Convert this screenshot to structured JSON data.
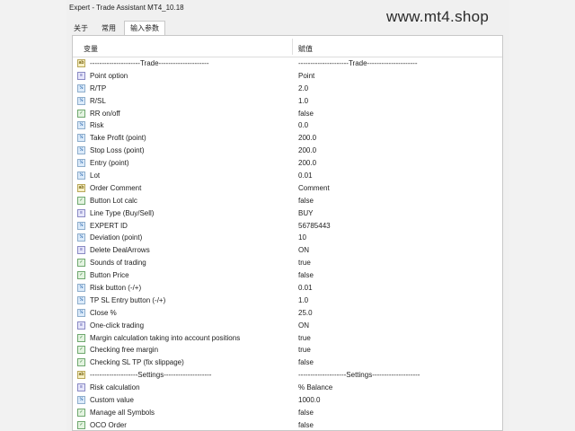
{
  "window": {
    "title": "Expert - Trade Assistant MT4_10.18",
    "watermark": "www.mt4.shop"
  },
  "tabs": [
    {
      "label": "关于",
      "active": false
    },
    {
      "label": "常用",
      "active": false
    },
    {
      "label": "输入参数",
      "active": true
    }
  ],
  "table": {
    "columns": {
      "variable": "变量",
      "value": "赋值"
    },
    "rows": [
      {
        "name": "---------------------Trade---------------------",
        "value": "---------------------Trade---------------------",
        "type": "text",
        "icon": "text-icon"
      },
      {
        "name": "Point option",
        "value": "Point",
        "type": "enum",
        "icon": "enum-icon"
      },
      {
        "name": "R/TP",
        "value": "2.0",
        "type": "number",
        "icon": "number-icon"
      },
      {
        "name": "R/SL",
        "value": "1.0",
        "type": "number",
        "icon": "number-icon"
      },
      {
        "name": "RR on/off",
        "value": "false",
        "type": "bool",
        "icon": "bool-icon"
      },
      {
        "name": "Risk",
        "value": "0.0",
        "type": "number",
        "icon": "number-icon"
      },
      {
        "name": "Take Profit (point)",
        "value": "200.0",
        "type": "number",
        "icon": "number-icon"
      },
      {
        "name": "Stop Loss (point)",
        "value": "200.0",
        "type": "number",
        "icon": "number-icon"
      },
      {
        "name": "Entry (point)",
        "value": "200.0",
        "type": "number",
        "icon": "number-icon"
      },
      {
        "name": "Lot",
        "value": "0.01",
        "type": "number",
        "icon": "number-icon"
      },
      {
        "name": "Order Comment",
        "value": "Comment",
        "type": "text",
        "icon": "text-icon"
      },
      {
        "name": "Button Lot calc",
        "value": "false",
        "type": "bool",
        "icon": "bool-icon"
      },
      {
        "name": "Line Type (Buy/Sell)",
        "value": "BUY",
        "type": "enum",
        "icon": "enum-icon"
      },
      {
        "name": "EXPERT ID",
        "value": "56785443",
        "type": "number",
        "icon": "number-icon"
      },
      {
        "name": "Deviation (point)",
        "value": "10",
        "type": "number",
        "icon": "number-icon"
      },
      {
        "name": "Delete DealArrows",
        "value": "ON",
        "type": "enum",
        "icon": "enum-icon"
      },
      {
        "name": "Sounds of trading",
        "value": "true",
        "type": "bool",
        "icon": "bool-icon"
      },
      {
        "name": "Button Price",
        "value": "false",
        "type": "bool",
        "icon": "bool-icon"
      },
      {
        "name": "Risk button (-/+)",
        "value": "0.01",
        "type": "number",
        "icon": "number-icon"
      },
      {
        "name": "TP SL Entry button (-/+)",
        "value": "1.0",
        "type": "number",
        "icon": "number-icon"
      },
      {
        "name": "Close %",
        "value": "25.0",
        "type": "number",
        "icon": "number-icon"
      },
      {
        "name": "One-click trading",
        "value": "ON",
        "type": "enum",
        "icon": "enum-icon"
      },
      {
        "name": "Margin calculation taking into account positions",
        "value": "true",
        "type": "bool",
        "icon": "bool-icon"
      },
      {
        "name": "Checking free margin",
        "value": "true",
        "type": "bool",
        "icon": "bool-icon"
      },
      {
        "name": "Checking SL TP (fix slippage)",
        "value": "false",
        "type": "bool",
        "icon": "bool-icon"
      },
      {
        "name": "--------------------Settings--------------------",
        "value": "--------------------Settings--------------------",
        "type": "text",
        "icon": "text-icon"
      },
      {
        "name": "Risk calculation",
        "value": "% Balance",
        "type": "enum",
        "icon": "enum-icon"
      },
      {
        "name": "Custom value",
        "value": "1000.0",
        "type": "number",
        "icon": "number-icon"
      },
      {
        "name": "Manage all Symbols",
        "value": "false",
        "type": "bool",
        "icon": "bool-icon"
      },
      {
        "name": "OCO Order",
        "value": "false",
        "type": "bool",
        "icon": "bool-icon"
      }
    ]
  }
}
